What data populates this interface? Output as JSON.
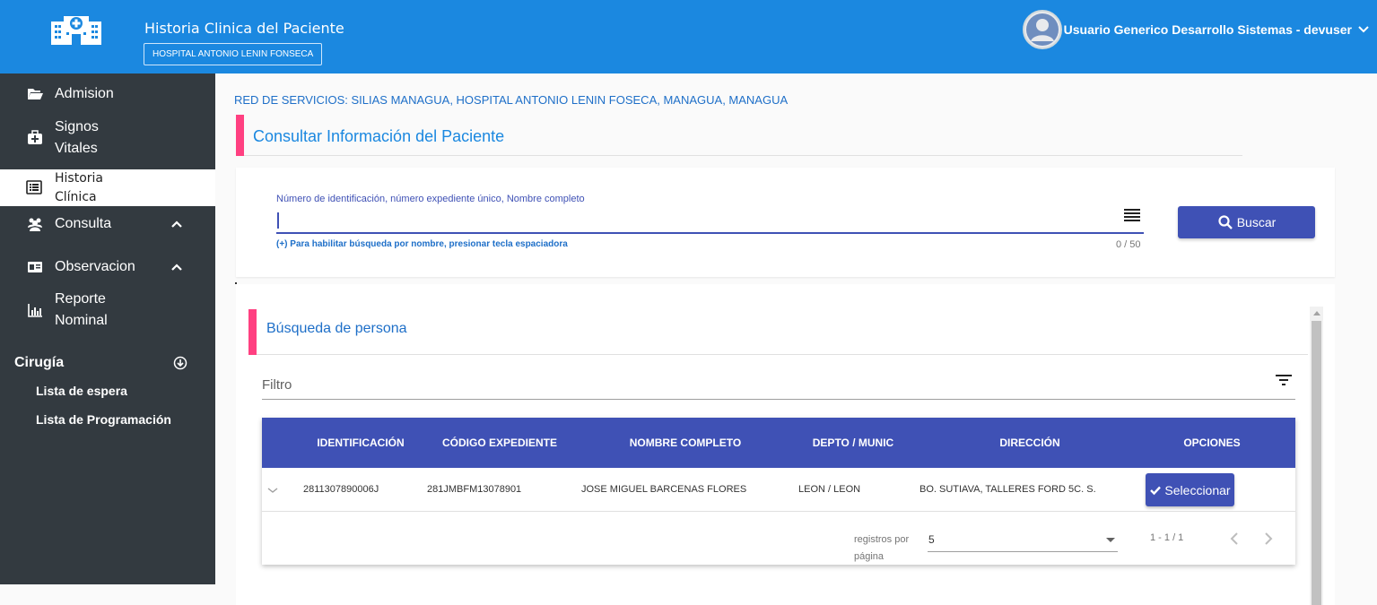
{
  "header": {
    "app_title": "Historia Clinica del Paciente",
    "hospital": "HOSPITAL ANTONIO LENIN FONSECA",
    "user_name": "Usuario Generico Desarrollo Sistemas - devuser",
    "logo_icon": "hospital-icon",
    "background": "#1b88e0"
  },
  "sidebar": {
    "items": [
      {
        "label": "Admision",
        "icon": "folder-open-icon"
      },
      {
        "label": "Signos Vitales",
        "line1": "Signos",
        "line2": "Vitales",
        "icon": "medkit-icon"
      },
      {
        "label": "Historia Clínica",
        "line1": "Historia",
        "line2": "Clínica",
        "icon": "list-alt-icon",
        "active": true
      },
      {
        "label": "Consulta",
        "icon": "users-icon",
        "expanded": true
      },
      {
        "label": "Observacion",
        "icon": "id-card-icon",
        "expanded": true
      },
      {
        "label": "Reporte Nominal",
        "line1": "Reporte",
        "line2": "Nominal",
        "icon": "bar-chart-icon"
      }
    ],
    "section": {
      "title": "Cirugía",
      "icon": "arrow-circle-down-icon"
    },
    "sub_items": [
      "Lista de espera",
      "Lista de Programación"
    ],
    "background": "#333a40"
  },
  "main": {
    "network": "RED DE SERVICIOS: SILIAS MANAGUA, HOSPITAL ANTONIO LENIN FOSECA, MANAGUA, MANAGUA",
    "section_title": "Consultar Información del Paciente",
    "search": {
      "label": "Número de identificación, número expediente único, Nombre completo",
      "value": "",
      "hint": "(+) Para habilitar búsqueda por nombre, presionar tecla espaciadora",
      "counter": "0 / 50",
      "button": "Buscar"
    },
    "person_section": {
      "title": "Búsqueda de persona",
      "filter_placeholder": "Filtro"
    },
    "table": {
      "columns": [
        "IDENTIFICACIÓN",
        "CÓDIGO EXPEDIENTE",
        "NOMBRE COMPLETO",
        "DEPTO / MUNIC",
        "DIRECCIÓN",
        "OPCIONES"
      ],
      "rows": [
        {
          "identificacion": "2811307890006J",
          "codigo": "281JMBFM13078901",
          "nombre": "JOSE MIGUEL BARCENAS FLORES",
          "depto": "LEON / LEON",
          "direccion": "BO. SUTIAVA, TALLERES FORD 5C. S.",
          "action": "Seleccionar"
        }
      ]
    },
    "pager": {
      "label": "registros por página",
      "label_line1": "registros por",
      "label_line2": "página",
      "page_size": "5",
      "range": "1 - 1 / 1"
    },
    "accent": "#ff4081",
    "primary": "#3f51b5"
  }
}
